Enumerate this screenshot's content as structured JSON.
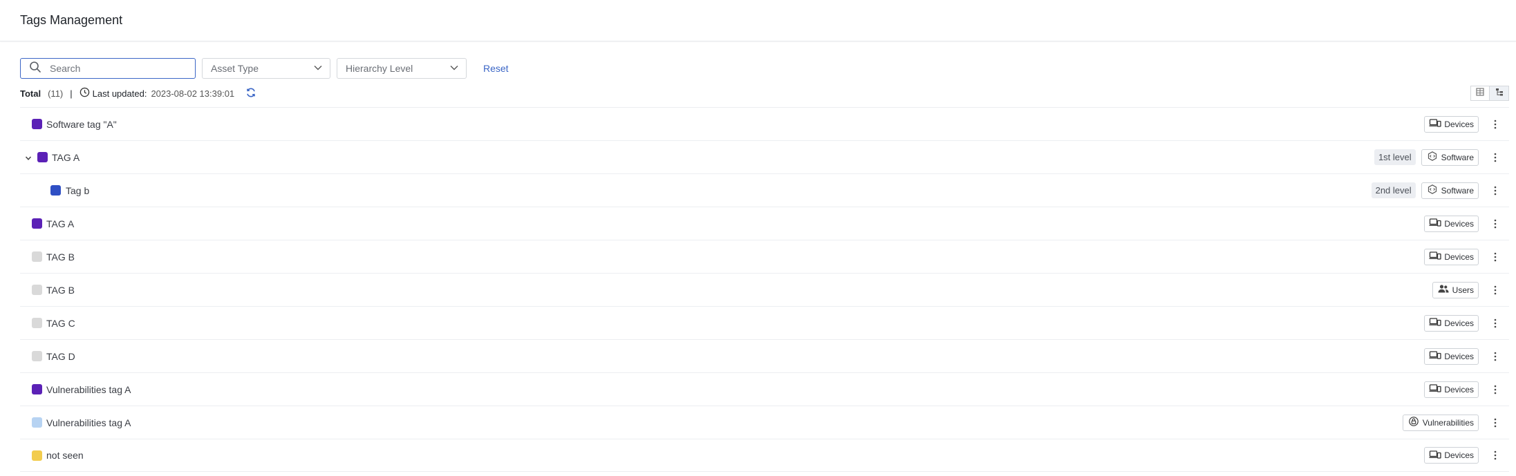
{
  "header": {
    "title": "Tags Management"
  },
  "filters": {
    "search_placeholder": "Search",
    "asset_type": "Asset Type",
    "hierarchy_level": "Hierarchy Level",
    "reset": "Reset"
  },
  "status": {
    "total_label": "Total",
    "count": "(11)",
    "separator": "|",
    "updated_label": "Last updated:",
    "updated_value": "2023-08-02 13:39:01"
  },
  "rows": [
    {
      "name": "Software tag \"A\"",
      "color": "#5b21b6",
      "level": "",
      "asset": "Devices",
      "asset_icon": "devices-icon"
    },
    {
      "name": "TAG A",
      "color": "#5b21b6",
      "level": "1st level",
      "asset": "Software",
      "asset_icon": "software-icon",
      "expanded": true
    },
    {
      "name": "Tag b",
      "color": "#2f4fc4",
      "level": "2nd level",
      "asset": "Software",
      "asset_icon": "software-icon",
      "child": true
    },
    {
      "name": "TAG A",
      "color": "#5b21b6",
      "level": "",
      "asset": "Devices",
      "asset_icon": "devices-icon"
    },
    {
      "name": "TAG B",
      "color": "#d9d9d9",
      "level": "",
      "asset": "Devices",
      "asset_icon": "devices-icon"
    },
    {
      "name": "TAG B",
      "color": "#d9d9d9",
      "level": "",
      "asset": "Users",
      "asset_icon": "users-icon"
    },
    {
      "name": "TAG C",
      "color": "#d9d9d9",
      "level": "",
      "asset": "Devices",
      "asset_icon": "devices-icon"
    },
    {
      "name": "TAG D",
      "color": "#d9d9d9",
      "level": "",
      "asset": "Devices",
      "asset_icon": "devices-icon"
    },
    {
      "name": "Vulnerabilities tag A",
      "color": "#5b21b6",
      "level": "",
      "asset": "Devices",
      "asset_icon": "devices-icon"
    },
    {
      "name": "Vulnerabilities tag A",
      "color": "#b7d3f2",
      "level": "",
      "asset": "Vulnerabilities",
      "asset_icon": "vulnerabilities-icon"
    },
    {
      "name": "not seen",
      "color": "#f2cc4d",
      "level": "",
      "asset": "Devices",
      "asset_icon": "devices-icon"
    }
  ],
  "colors": {
    "accent": "#3b66c6"
  }
}
